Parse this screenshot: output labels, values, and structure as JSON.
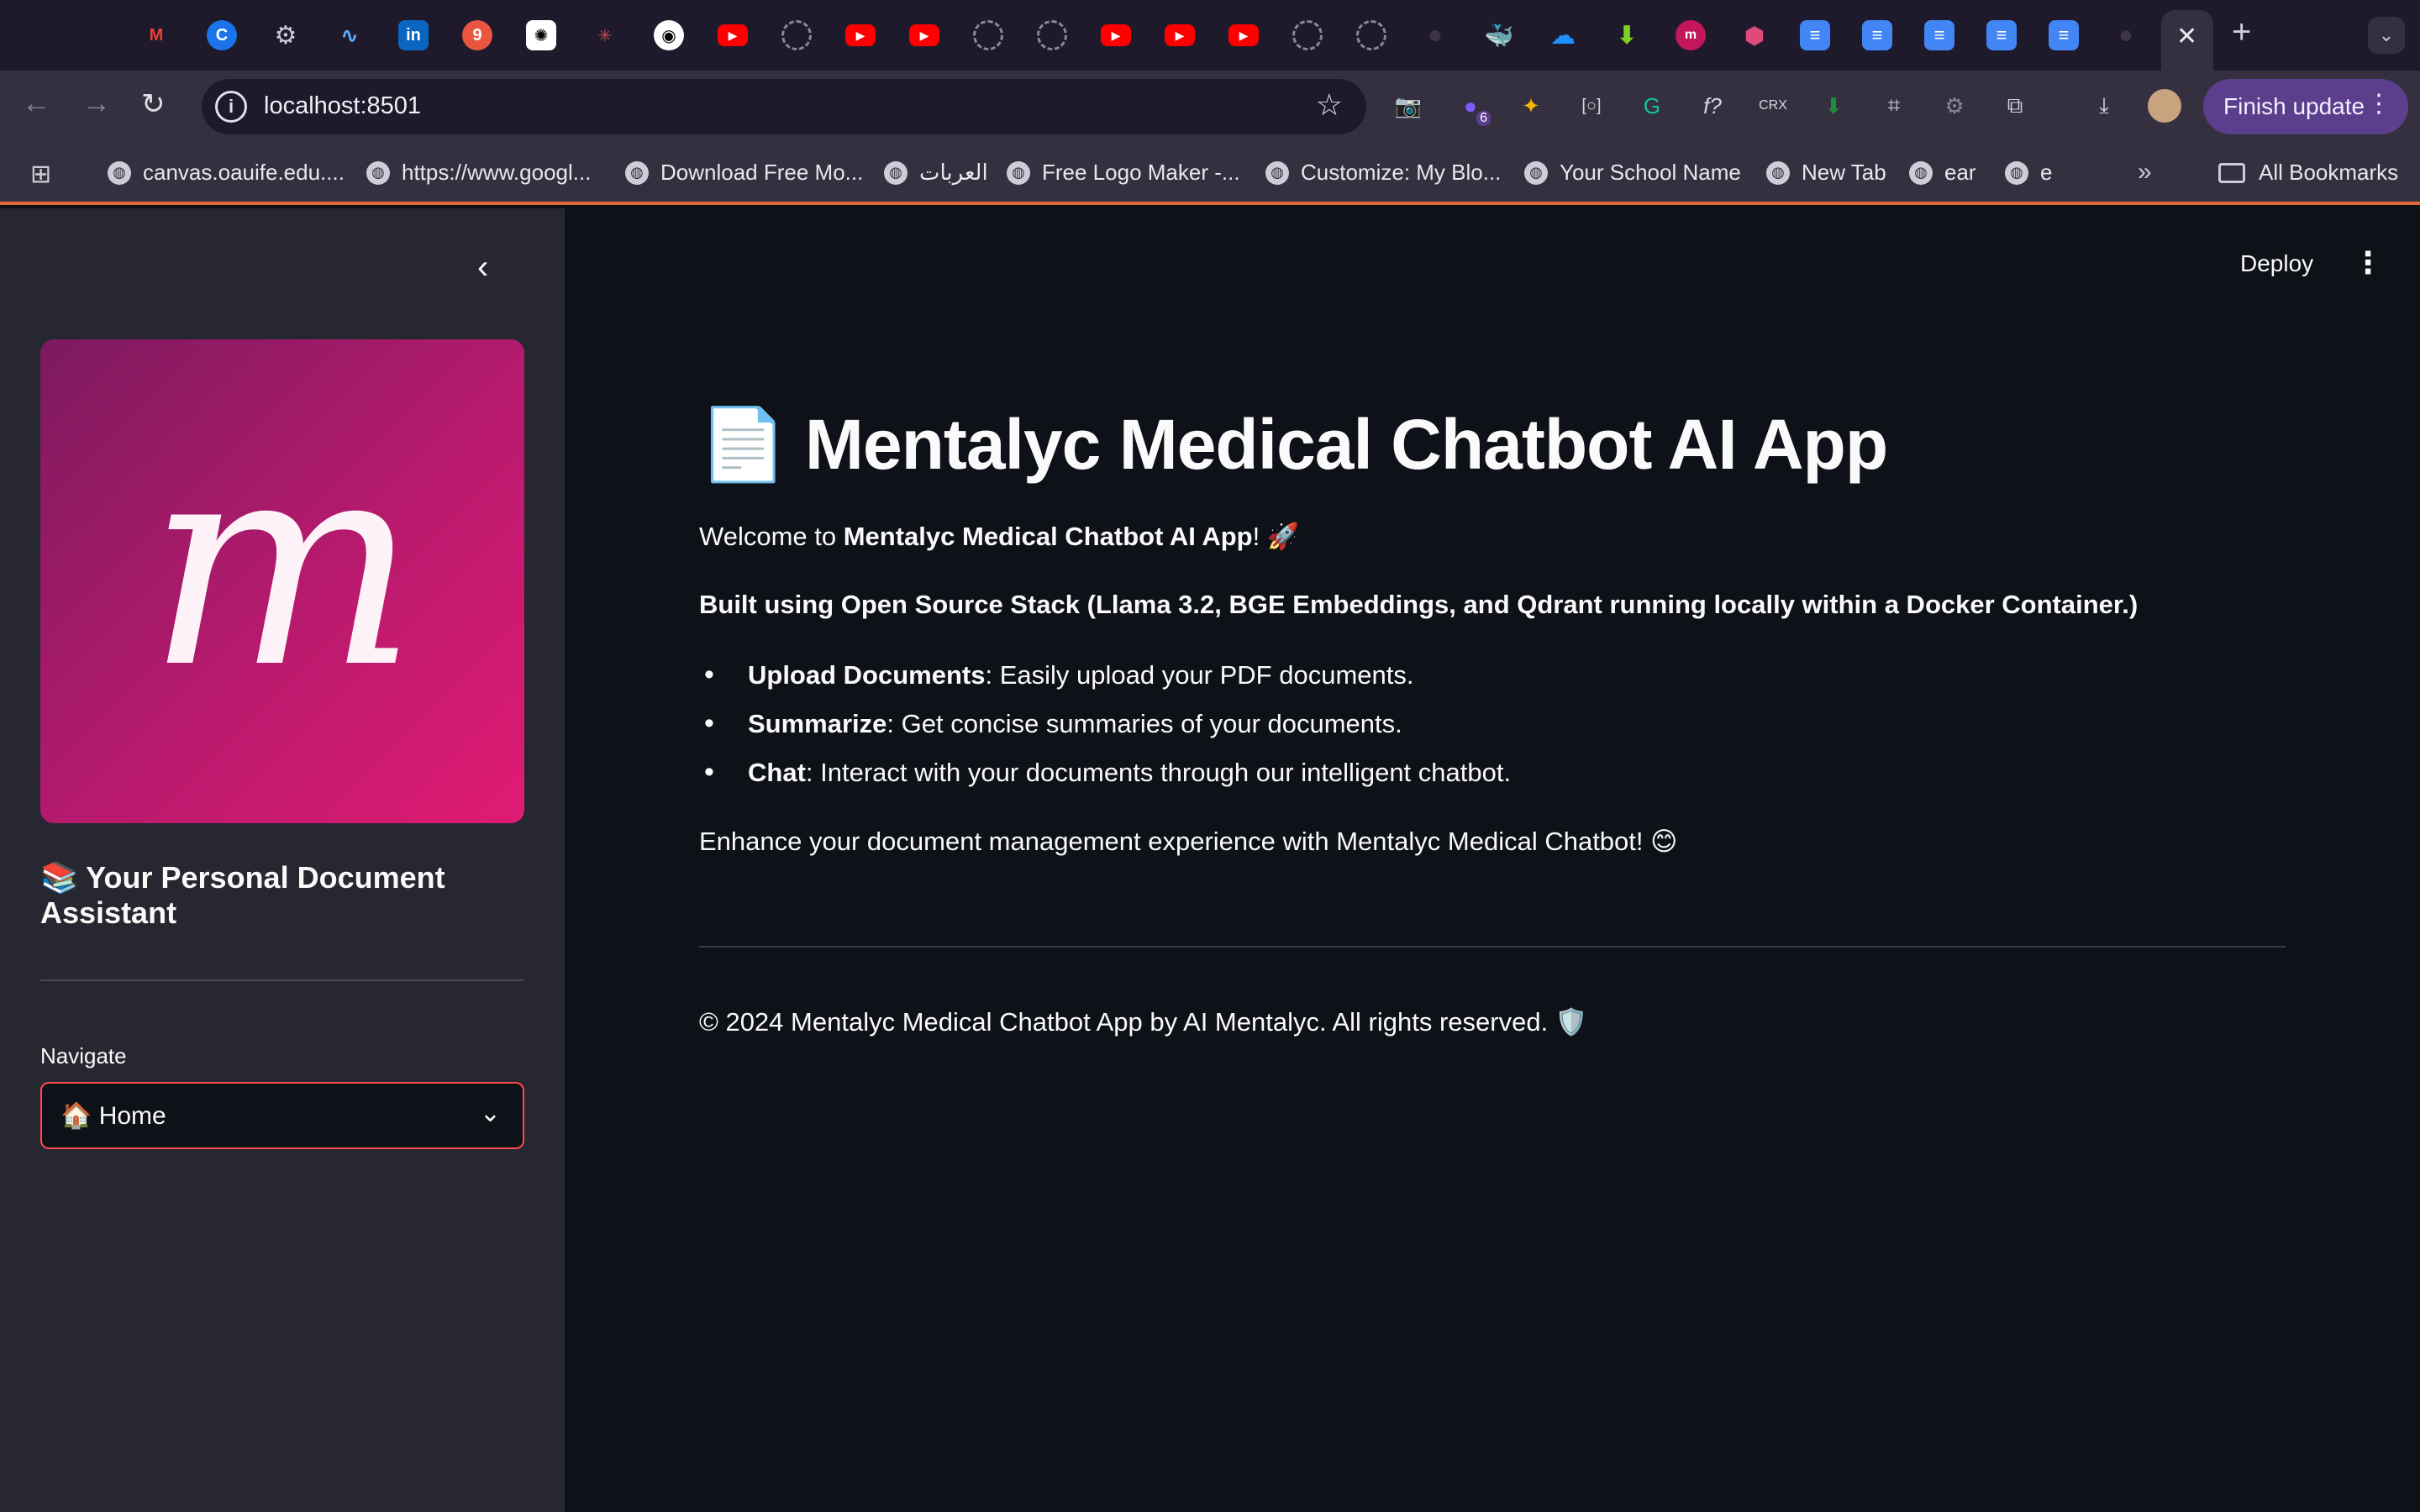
{
  "browser": {
    "tab_favicons": [
      "gmail-icon",
      "grammarly-icon",
      "gear-icon",
      "pulse-icon",
      "linkedin-icon",
      "badge-icon",
      "openai-icon",
      "sparkle-icon",
      "github-octocat-icon",
      "youtube-icon",
      "loading-icon",
      "youtube-icon",
      "youtube-icon",
      "loading-icon",
      "loading-icon",
      "youtube-icon",
      "youtube-icon",
      "youtube-icon",
      "loading-icon",
      "loading-icon",
      "github-icon",
      "docker-icon",
      "onedrive-icon",
      "download-arrow-icon",
      "mentalyc-icon",
      "cube-icon",
      "google-docs-icon",
      "google-docs-icon",
      "google-docs-icon",
      "google-docs-icon",
      "google-docs-icon",
      "github-icon"
    ],
    "active_tab_close": "✕",
    "new_tab": "+",
    "address_bar": {
      "url": "localhost:8501"
    },
    "extension_badge": "6",
    "finish_update_label": "Finish update",
    "bookmarks": [
      "canvas.oauife.edu....",
      "https://www.googl...",
      "Download Free Mo...",
      "العربات",
      "Free Logo Maker -...",
      "Customize: My Blo...",
      "Your School Name",
      "New Tab",
      "ear",
      "e"
    ],
    "all_bookmarks_label": "All Bookmarks"
  },
  "sidebar": {
    "logo_letter": "m",
    "tagline": "📚 Your Personal Document Assistant",
    "nav_label": "Navigate",
    "nav_selected": "🏠 Home"
  },
  "header": {
    "deploy_label": "Deploy"
  },
  "main": {
    "title": "📄 Mentalyc Medical Chatbot AI App",
    "welcome_prefix": "Welcome to ",
    "welcome_bold": "Mentalyc Medical Chatbot AI App",
    "welcome_suffix": "! 🚀",
    "built_with": "Built using Open Source Stack (Llama 3.2, BGE Embeddings, and Qdrant running locally within a Docker Container.)",
    "features": [
      {
        "name": "Upload Documents",
        "desc": ": Easily upload your PDF documents."
      },
      {
        "name": "Summarize",
        "desc": ": Get concise summaries of your documents."
      },
      {
        "name": "Chat",
        "desc": ": Interact with your documents through our intelligent chatbot."
      }
    ],
    "closing": "Enhance your document management experience with Mentalyc Medical Chatbot! 😊",
    "footer": "© 2024 Mentalyc Medical Chatbot App by AI Mentalyc. All rights reserved. 🛡️"
  }
}
